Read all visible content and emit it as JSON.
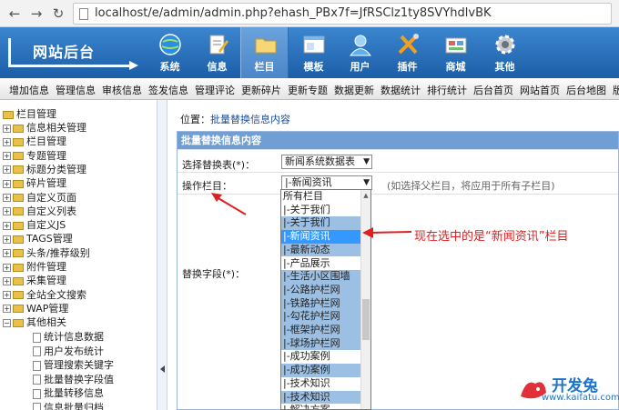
{
  "browser": {
    "url": "localhost/e/admin/admin.php?ehash_PBx7f=JfRSClz1ty8SVYhdlvBK"
  },
  "header": {
    "logo": "网站后台",
    "nav": [
      {
        "label": "系统",
        "icon": "globe-icon"
      },
      {
        "label": "信息",
        "icon": "document-edit-icon"
      },
      {
        "label": "栏目",
        "icon": "folder-icon",
        "active": true
      },
      {
        "label": "模板",
        "icon": "window-icon"
      },
      {
        "label": "用户",
        "icon": "user-icon"
      },
      {
        "label": "插件",
        "icon": "tools-icon"
      },
      {
        "label": "商城",
        "icon": "store-icon"
      },
      {
        "label": "其他",
        "icon": "gear-icon"
      }
    ]
  },
  "subnav": [
    "增加信息",
    "管理信息",
    "审核信息",
    "签发信息",
    "管理评论",
    "更新碎片",
    "更新专题",
    "数据更新",
    "数据统计",
    "排行统计",
    "后台首页",
    "网站首页",
    "后台地图",
    "版"
  ],
  "tree": {
    "root": "栏目管理",
    "items": [
      "信息相关管理",
      "栏目管理",
      "专题管理",
      "标题分类管理",
      "碎片管理",
      "自定义页面",
      "自定义列表",
      "自定义JS",
      "TAGS管理",
      "头条/推荐级别",
      "附件管理",
      "采集管理",
      "全站全文搜索",
      "WAP管理",
      "其他相关"
    ],
    "children": [
      "统计信息数据",
      "用户发布统计",
      "管理搜索关键字",
      "批量替换字段值",
      "批量转移信息",
      "信息批量归档"
    ]
  },
  "main": {
    "crumb_prefix": "位置：",
    "crumb_current": "批量替换信息内容",
    "form_title": "批量替换信息内容",
    "table_label": "选择替换表(*)：",
    "table_value": "新闻系统数据表",
    "column_label": "操作栏目：",
    "column_value": "|-新闻资讯",
    "column_hint": "(如选择父栏目，将应用于所有子栏目)",
    "field_label": "替换字段(*)：",
    "options": [
      "所有栏目",
      "|-关于我们",
      " |-关于我们",
      "|-新闻资讯",
      " |-最新动态",
      "|-产品展示",
      " |-生活小区围墙",
      " |-公路护栏网",
      " |-铁路护栏网",
      " |-勾花护栏网",
      " |-框架护栏网",
      " |-球场护栏网",
      "|-成功案例",
      " |-成功案例",
      "|-技术知识",
      " |-技术知识",
      "|-解决方案"
    ]
  },
  "annotation": "现在选中的是“新闻资讯”栏目",
  "watermark": {
    "text": "开发兔",
    "url": "www.kaifatu.com"
  },
  "colors": {
    "header": "#1c5ea8",
    "selected": "#3399ff",
    "child_highlight": "#9cc0e4",
    "annotation": "#e02020"
  }
}
